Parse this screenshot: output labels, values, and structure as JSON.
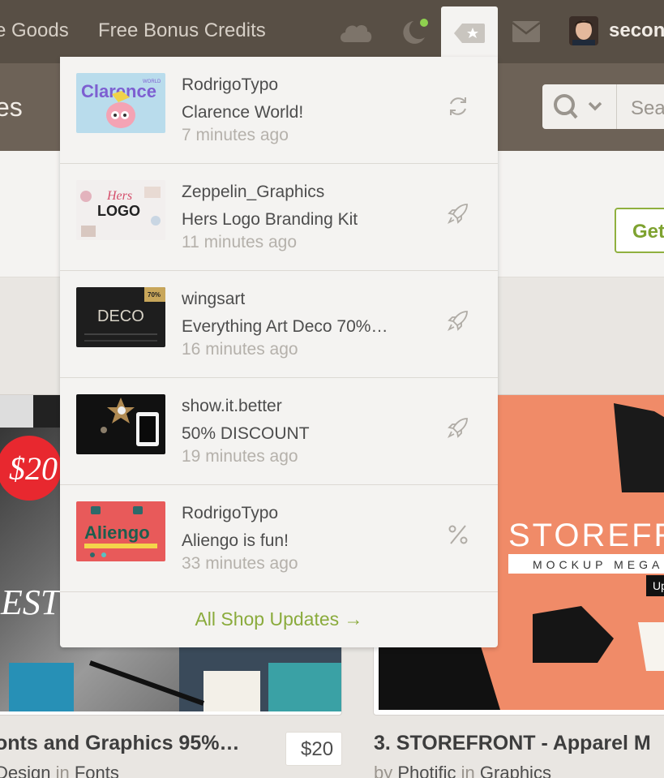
{
  "topnav": {
    "links": [
      "e Goods",
      "Free Bonus Credits"
    ],
    "icons": [
      "cloud-icon",
      "moon-notification-icon",
      "tag-star-icon",
      "mail-icon"
    ],
    "user": "secon",
    "accent": "#8fd14f"
  },
  "subheader": {
    "title": "es",
    "search_placeholder": "Sea"
  },
  "band": {
    "button_label": "Get"
  },
  "dropdown": {
    "items": [
      {
        "author": "RodrigoTypo",
        "title": "Clarence World!",
        "time": "7 minutes ago",
        "action_icon": "refresh-icon"
      },
      {
        "author": "Zeppelin_Graphics",
        "title": "Hers Logo Branding Kit",
        "time": "11 minutes ago",
        "action_icon": "rocket-icon"
      },
      {
        "author": "wingsart",
        "title": "Everything Art Deco 70%…",
        "time": "16 minutes ago",
        "action_icon": "rocket-icon"
      },
      {
        "author": "show.it.better",
        "title": "50% DISCOUNT",
        "time": "19 minutes ago",
        "action_icon": "rocket-icon"
      },
      {
        "author": "RodrigoTypo",
        "title": "Aliengo is fun!",
        "time": "33 minutes ago",
        "action_icon": "percent-icon"
      }
    ],
    "footer_link": "All Shop Updates →"
  },
  "thumbs": {
    "clarence": "Clarence",
    "clarence_sub": "WORLD",
    "hers": "Hers",
    "logo": "LOGO",
    "deco": "DECO",
    "deco_badge": "70%",
    "aliengo": "Aliengo"
  },
  "cards": [
    {
      "title": "onts and Graphics 95%…",
      "byline_prefix": "Design",
      "byline_in": "in",
      "byline_category": "Fonts",
      "price": "$20",
      "art_price": "$20",
      "art_text": "EST S"
    },
    {
      "title": "3. STOREFRONT - Apparel M",
      "byline_by": "by",
      "byline_author": "Photific",
      "byline_in": "in",
      "byline_category": "Graphics",
      "art_text": "STOREFRO",
      "art_subtext": "MOCKUP MEGA-BU",
      "art_badge": "Up"
    }
  ]
}
